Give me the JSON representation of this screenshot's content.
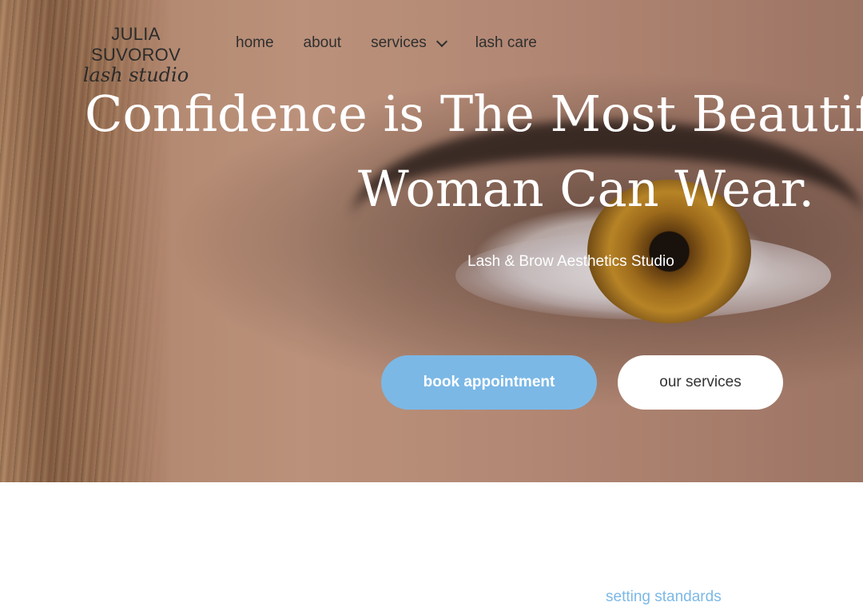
{
  "logo": {
    "line1": "JULIA SUVOROV",
    "line2": "lash studio"
  },
  "nav": [
    {
      "label": "home"
    },
    {
      "label": "about"
    },
    {
      "label": "services"
    },
    {
      "label": "lash care"
    }
  ],
  "hero": {
    "headline_line1": "Confidence is The Most Beautiful",
    "headline_line2": "Woman Can Wear.",
    "subtitle": "Lash & Brow Aesthetics Studio",
    "primary_button": "book appointment",
    "secondary_button": "our services"
  },
  "section": {
    "label": "setting standards"
  },
  "colors": {
    "accent": "#7bb8e6",
    "nav_text": "#2f2f2f",
    "hero_text": "#ffffff"
  }
}
